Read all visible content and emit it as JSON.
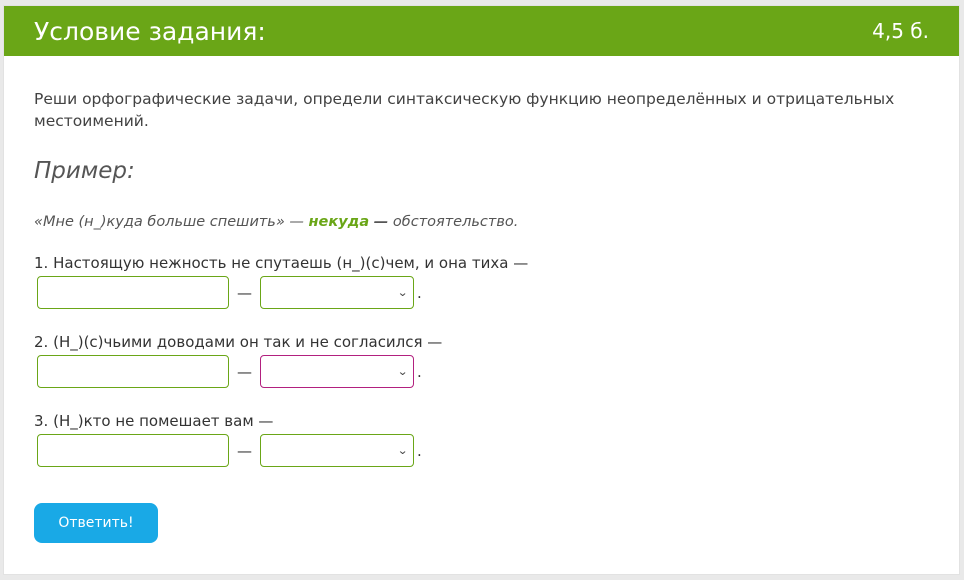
{
  "header": {
    "title": "Условие задания:",
    "score": "4,5 б."
  },
  "instruction": "Реши орфографические задачи, определи синтаксическую функцию неопределённых и отрицательных местоимений.",
  "example": {
    "heading": "Пример:",
    "quote": "«Мне (н_)куда больше спешить» —",
    "answer": "некуда",
    "dash": "—",
    "role": "обстоятельство."
  },
  "questions": [
    {
      "number": "1.",
      "text": "Настоящую нежность не спутаешь (н_)(с)чем, и она тиха —",
      "input_value": "",
      "select_value": "",
      "select_invalid": false
    },
    {
      "number": "2.",
      "text": "(Н_)(с)чьими доводами он так и не согласился —",
      "input_value": "",
      "select_value": "",
      "select_invalid": true
    },
    {
      "number": "3.",
      "text": "(Н_)кто не помешает вам —",
      "input_value": "",
      "select_value": "",
      "select_invalid": false
    }
  ],
  "separator": "—",
  "period": ".",
  "submit_label": "Ответить!",
  "colors": {
    "header": "#6aa617",
    "button": "#19a9e6",
    "invalid_border": "#b2207f"
  }
}
